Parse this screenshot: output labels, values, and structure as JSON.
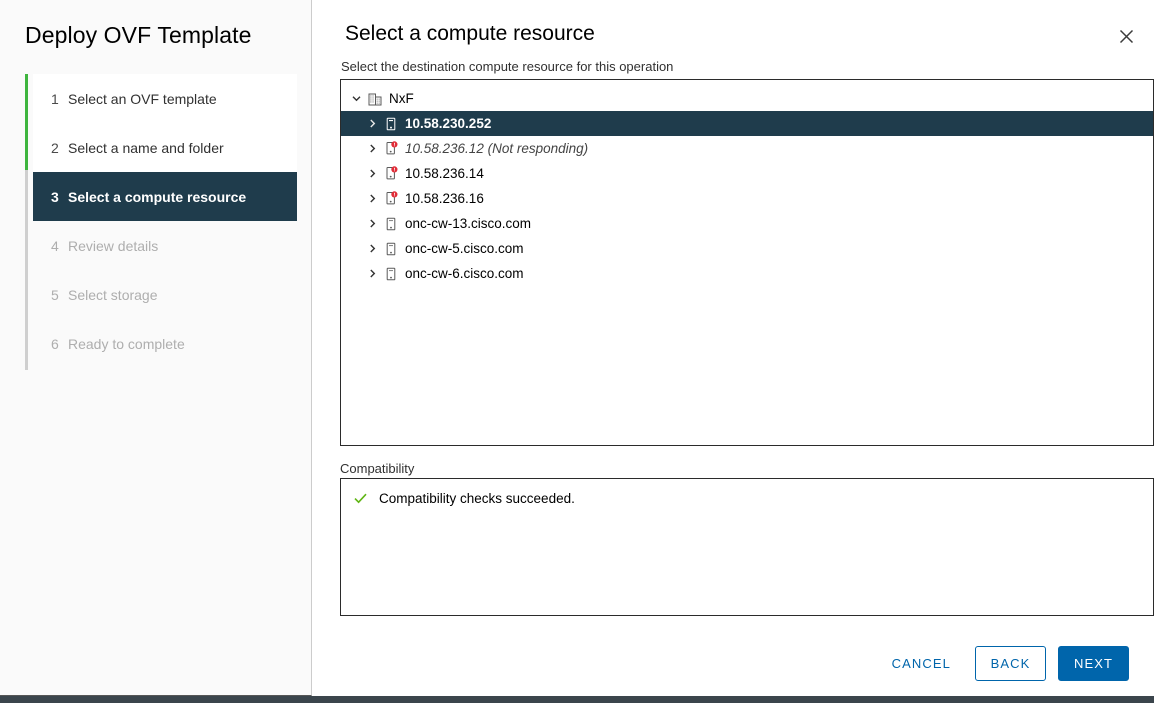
{
  "wizard": {
    "title": "Deploy OVF Template",
    "steps": [
      {
        "num": "1",
        "label": "Select an OVF template",
        "state": "done"
      },
      {
        "num": "2",
        "label": "Select a name and folder",
        "state": "done"
      },
      {
        "num": "3",
        "label": "Select a compute resource",
        "state": "active"
      },
      {
        "num": "4",
        "label": "Review details",
        "state": "todo"
      },
      {
        "num": "5",
        "label": "Select storage",
        "state": "todo"
      },
      {
        "num": "6",
        "label": "Ready to complete",
        "state": "todo"
      }
    ]
  },
  "page": {
    "title": "Select a compute resource",
    "subtitle": "Select the destination compute resource for this operation",
    "close_icon": "close-icon"
  },
  "tree": {
    "nodes": [
      {
        "label": "NxF",
        "icon": "datacenter-icon",
        "level": 0,
        "expanded": true,
        "selected": false,
        "warning": false,
        "dim": false
      },
      {
        "label": "10.58.230.252",
        "icon": "host-icon",
        "level": 1,
        "expanded": false,
        "selected": true,
        "warning": false,
        "dim": false
      },
      {
        "label": "10.58.236.12 (Not responding)",
        "icon": "host-icon",
        "level": 1,
        "expanded": false,
        "selected": false,
        "warning": true,
        "dim": true
      },
      {
        "label": "10.58.236.14",
        "icon": "host-icon",
        "level": 1,
        "expanded": false,
        "selected": false,
        "warning": true,
        "dim": false
      },
      {
        "label": "10.58.236.16",
        "icon": "host-icon",
        "level": 1,
        "expanded": false,
        "selected": false,
        "warning": true,
        "dim": false
      },
      {
        "label": "onc-cw-13.cisco.com",
        "icon": "host-icon",
        "level": 1,
        "expanded": false,
        "selected": false,
        "warning": false,
        "dim": false
      },
      {
        "label": "onc-cw-5.cisco.com",
        "icon": "host-icon",
        "level": 1,
        "expanded": false,
        "selected": false,
        "warning": false,
        "dim": false
      },
      {
        "label": "onc-cw-6.cisco.com",
        "icon": "host-icon",
        "level": 1,
        "expanded": false,
        "selected": false,
        "warning": false,
        "dim": false
      }
    ]
  },
  "compatibility": {
    "label": "Compatibility",
    "status_icon": "check-icon",
    "message": "Compatibility checks succeeded."
  },
  "footer": {
    "cancel_label": "CANCEL",
    "back_label": "BACK",
    "next_label": "NEXT"
  },
  "colors": {
    "accent": "#0065ab",
    "selected_row": "#1f3c4c",
    "progress_done": "#3eb53e",
    "warning_badge": "#e12d39",
    "success_check": "#60b515"
  }
}
